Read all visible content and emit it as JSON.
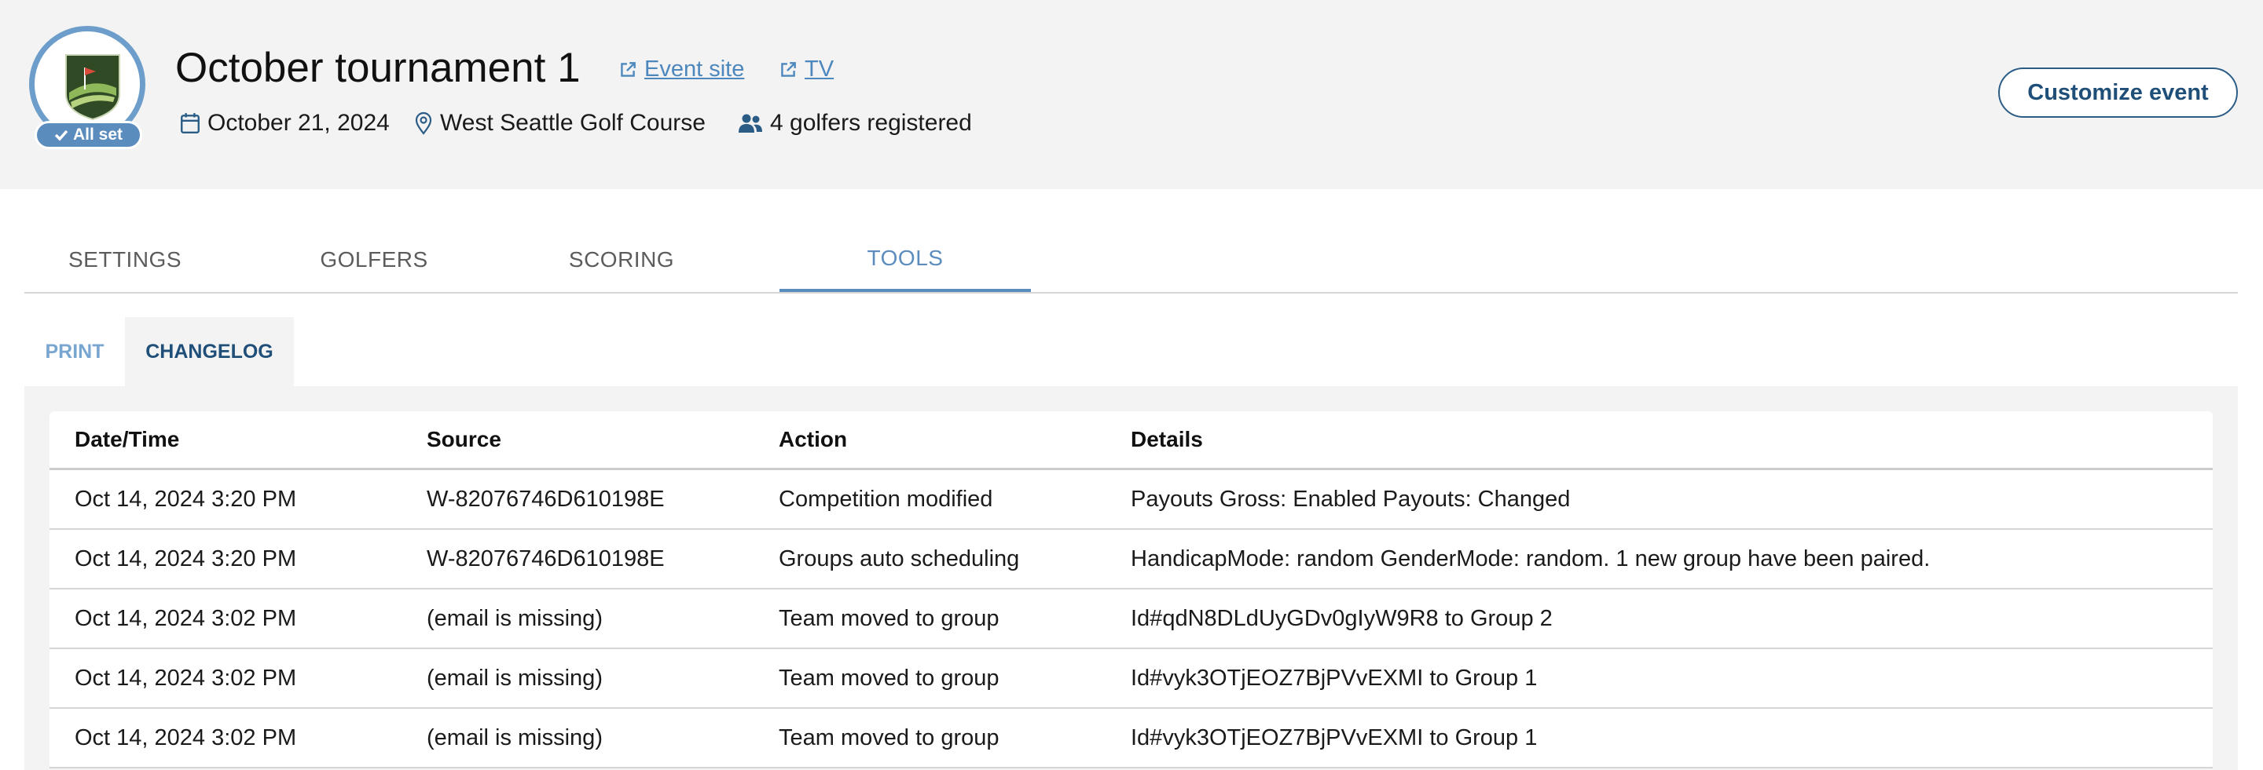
{
  "event": {
    "title": "October tournament 1",
    "status_badge": "All set",
    "links": {
      "event_site": "Event site",
      "tv": "TV"
    },
    "date": "October 21, 2024",
    "location": "West Seattle Golf Course",
    "golfers": "4 golfers registered",
    "customize_label": "Customize event"
  },
  "tabs": [
    {
      "label": "SETTINGS"
    },
    {
      "label": "GOLFERS"
    },
    {
      "label": "SCORING"
    },
    {
      "label": "TOOLS"
    }
  ],
  "subtabs": [
    {
      "label": "PRINT"
    },
    {
      "label": "CHANGELOG"
    }
  ],
  "changelog": {
    "headers": [
      "Date/Time",
      "Source",
      "Action",
      "Details"
    ],
    "rows": [
      [
        "Oct 14, 2024 3:20 PM",
        "W-82076746D610198E",
        "Competition modified",
        "Payouts Gross: Enabled Payouts: Changed"
      ],
      [
        "Oct 14, 2024 3:20 PM",
        "W-82076746D610198E",
        "Groups auto scheduling",
        "HandicapMode: random GenderMode: random. 1 new group have been paired."
      ],
      [
        "Oct 14, 2024 3:02 PM",
        "(email is missing)",
        "Team moved to group",
        "Id#qdN8DLdUyGDv0gIyW9R8 to Group 2"
      ],
      [
        "Oct 14, 2024 3:02 PM",
        "(email is missing)",
        "Team moved to group",
        "Id#vyk3OTjEOZ7BjPVvEXMI to Group 1"
      ],
      [
        "Oct 14, 2024 3:02 PM",
        "(email is missing)",
        "Team moved to group",
        "Id#vyk3OTjEOZ7BjPVvEXMI to Group 1"
      ]
    ]
  },
  "colors": {
    "accent": "#5b8cbe",
    "dark_accent": "#1f4f78",
    "header_bg": "#f3f3f3"
  },
  "icons": [
    "golf-logo",
    "check-icon",
    "external-link-icon",
    "calendar-icon",
    "location-pin-icon",
    "users-icon"
  ]
}
